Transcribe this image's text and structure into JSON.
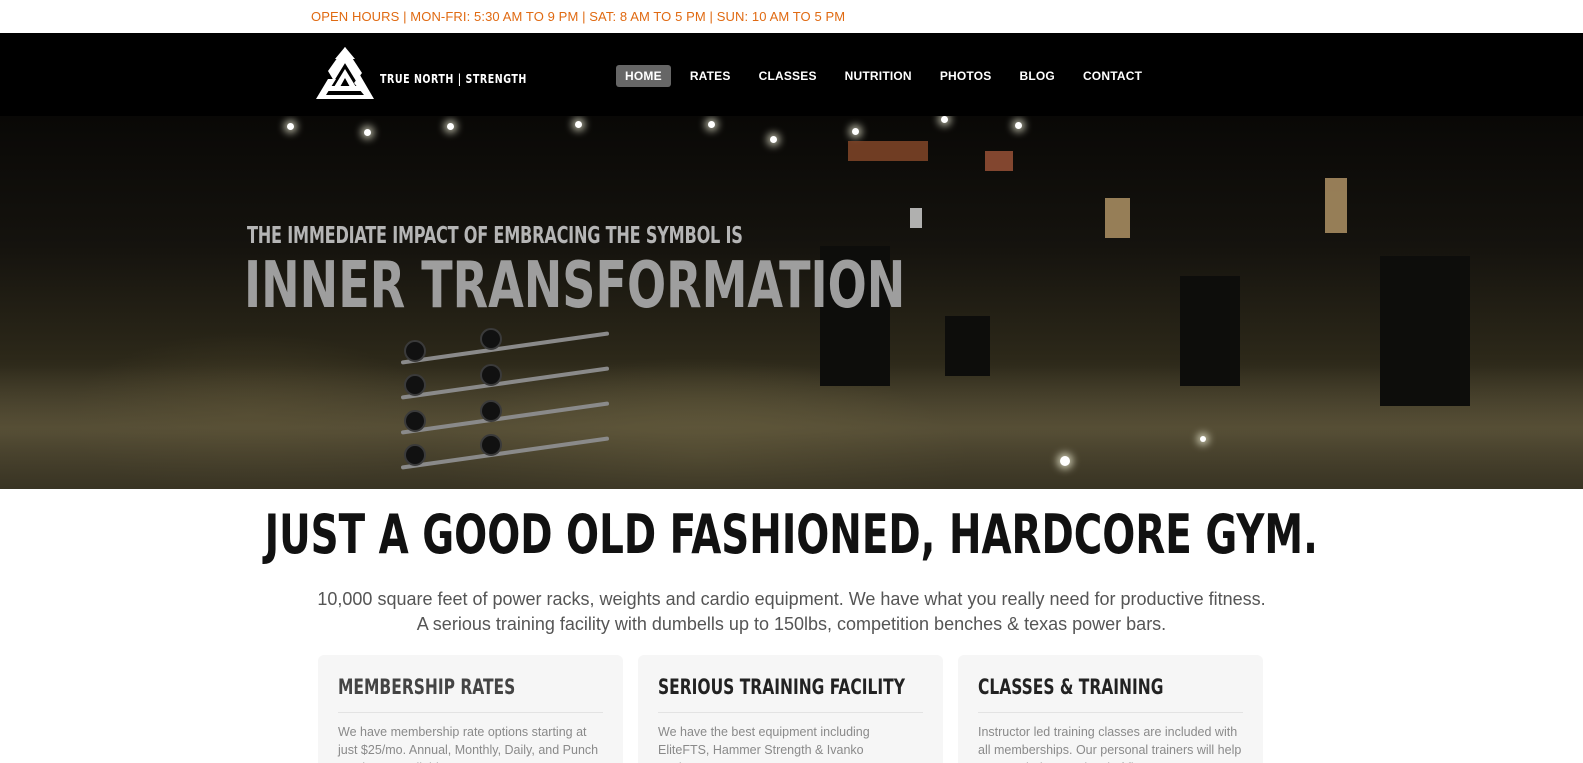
{
  "topbar": {
    "hours": "OPEN HOURS | MON-FRI: 5:30 AM TO 9 PM | SAT: 8 AM TO 5 PM | SUN: 10 AM TO 5 PM"
  },
  "header": {
    "brand": "TRUE NORTH | STRENGTH",
    "nav": [
      {
        "label": "HOME",
        "active": true
      },
      {
        "label": "RATES",
        "active": false
      },
      {
        "label": "CLASSES",
        "active": false
      },
      {
        "label": "NUTRITION",
        "active": false
      },
      {
        "label": "PHOTOS",
        "active": false
      },
      {
        "label": "BLOG",
        "active": false
      },
      {
        "label": "CONTACT",
        "active": false
      }
    ]
  },
  "hero": {
    "line1": "THE IMMEDIATE IMPACT OF EMBRACING THE SYMBOL IS",
    "line2": "INNER TRANSFORMATION"
  },
  "main": {
    "headline": "JUST A GOOD OLD FASHIONED, HARDCORE GYM.",
    "lead1": "10,000 square feet of power racks, weights and cardio equipment. We have what you really need for productive fitness.",
    "lead2": "A serious training facility with dumbells up to 150lbs, competition benches & texas power bars."
  },
  "cards": [
    {
      "title": "MEMBERSHIP RATES",
      "text": "We have membership rate options starting at just $25/mo. Annual, Monthly, Daily, and Punch Cards are available."
    },
    {
      "title": "SERIOUS TRAINING FACILITY",
      "text": "We have the best equipment including EliteFTS, Hammer Strength & Ivanko equipment."
    },
    {
      "title": "CLASSES & TRAINING",
      "text": "Instructor led training classes are included with all memberships. Our personal trainers will help you reach the next level of fitness."
    }
  ],
  "colors": {
    "accent": "#e06a12",
    "header_bg": "#000000",
    "nav_active_bg": "#666666"
  },
  "icons": {
    "logo": "valknut-triangle-icon"
  }
}
